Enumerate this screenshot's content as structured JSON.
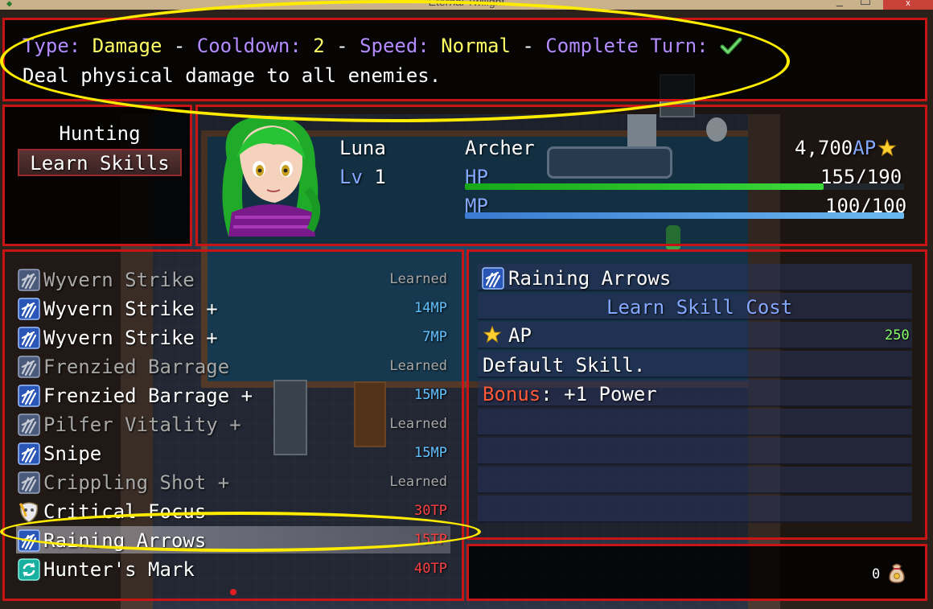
{
  "window": {
    "title": "Eternal Twilight",
    "minimize_glyph": "_",
    "close_glyph": "x"
  },
  "help": {
    "type_label": "Type:",
    "type_value": "Damage",
    "sep": "-",
    "cooldown_label": "Cooldown:",
    "cooldown_value": "2",
    "speed_label": "Speed:",
    "speed_value": "Normal",
    "complete_turn_label": "Complete Turn:",
    "complete_turn_icon": "checkmark-icon",
    "description": "Deal physical damage to all enemies."
  },
  "command": {
    "category": "Hunting",
    "button_label": "Learn Skills"
  },
  "actor": {
    "name": "Luna",
    "level_label": "Lv",
    "level": "1",
    "class": "Archer",
    "ap_value": "4,700",
    "ap_label": "AP",
    "hp_label": "HP",
    "hp_text": "155/190",
    "hp_fraction": 0.816,
    "mp_label": "MP",
    "mp_text": "100/100",
    "mp_fraction": 1.0
  },
  "skills": [
    {
      "name": "Wyvern Strike",
      "cost": "Learned",
      "state": "learned",
      "icon": "claw-icon"
    },
    {
      "name": "Wyvern Strike +",
      "cost": "14MP",
      "state": "mp",
      "icon": "claw-icon"
    },
    {
      "name": "Wyvern Strike +",
      "cost": "7MP",
      "state": "mp",
      "icon": "claw-icon"
    },
    {
      "name": "Frenzied Barrage",
      "cost": "Learned",
      "state": "learned",
      "icon": "claw-icon"
    },
    {
      "name": "Frenzied Barrage +",
      "cost": "15MP",
      "state": "mp",
      "icon": "claw-icon"
    },
    {
      "name": "Pilfer Vitality +",
      "cost": "Learned",
      "state": "learned",
      "icon": "claw-icon"
    },
    {
      "name": "Snipe",
      "cost": "15MP",
      "state": "mp",
      "icon": "claw-icon"
    },
    {
      "name": "Crippling Shot +",
      "cost": "Learned",
      "state": "learned",
      "icon": "claw-icon"
    },
    {
      "name": "Critical Focus",
      "cost": "30TP",
      "state": "tp",
      "icon": "mask-icon"
    },
    {
      "name": "Raining Arrows",
      "cost": "15TP",
      "state": "tp",
      "icon": "claw-icon",
      "selected": true
    },
    {
      "name": "Hunter's Mark",
      "cost": "40TP",
      "state": "tp",
      "icon": "cycle-icon"
    }
  ],
  "detail": {
    "skill_name": "Raining Arrows",
    "header": "Learn Skill Cost",
    "ap_label": "AP",
    "ap_cost": "250",
    "note": "Default Skill.",
    "bonus_label": "Bonus",
    "bonus_value": ": +1 Power"
  },
  "gold": {
    "value": "0",
    "icon": "coin-bag-icon"
  },
  "colors": {
    "window_border": "#c81414",
    "label_purple": "#b48cff",
    "value_yellow": "#ffff66",
    "hp_green": "#22c022",
    "mp_blue": "#4a9ae0",
    "highlight": "#ffeb00"
  }
}
